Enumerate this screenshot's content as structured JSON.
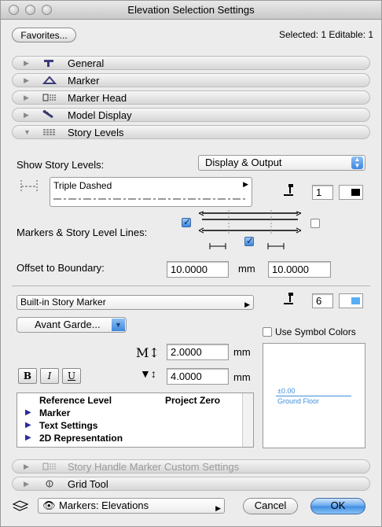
{
  "window": {
    "title": "Elevation Selection Settings"
  },
  "header": {
    "favorites_label": "Favorites...",
    "status": "Selected: 1 Editable: 1"
  },
  "sections": [
    {
      "label": "General",
      "icon": "general-icon"
    },
    {
      "label": "Marker",
      "icon": "marker-icon"
    },
    {
      "label": "Marker Head",
      "icon": "marker-head-icon"
    },
    {
      "label": "Model Display",
      "icon": "model-display-icon"
    },
    {
      "label": "Story Levels",
      "icon": "story-levels-icon"
    }
  ],
  "story_levels": {
    "show_label": "Show Story Levels:",
    "show_value": "Display & Output",
    "line_type": "Triple Dashed",
    "pen_value": "1",
    "markers_label": "Markers & Story Level Lines:",
    "offset_label": "Offset to Boundary:",
    "offset_left": "10.0000",
    "offset_unit": "mm",
    "offset_right": "10.0000"
  },
  "marker_settings": {
    "marker_type": "Built-in Story Marker",
    "pen_value": "6",
    "font": "Avant Garde...",
    "use_symbol_colors": "Use Symbol Colors",
    "size_value": "2.0000",
    "size_unit": "mm",
    "angle_value": "4.0000",
    "angle_unit": "mm",
    "bold": "B",
    "italic": "I",
    "underline": "U",
    "list_header_left": "Reference Level",
    "list_header_right": "Project Zero",
    "list_items": [
      "Marker",
      "Text Settings",
      "2D Representation"
    ],
    "preview_level": "±0.00",
    "preview_name": "Ground Floor"
  },
  "lower_sections": [
    {
      "label": "Story Handle Marker Custom Settings",
      "icon": "story-handle-icon"
    },
    {
      "label": "Grid Tool",
      "icon": "grid-tool-icon"
    }
  ],
  "footer": {
    "layer_popup": "Markers: Elevations",
    "cancel_label": "Cancel",
    "ok_label": "OK"
  }
}
